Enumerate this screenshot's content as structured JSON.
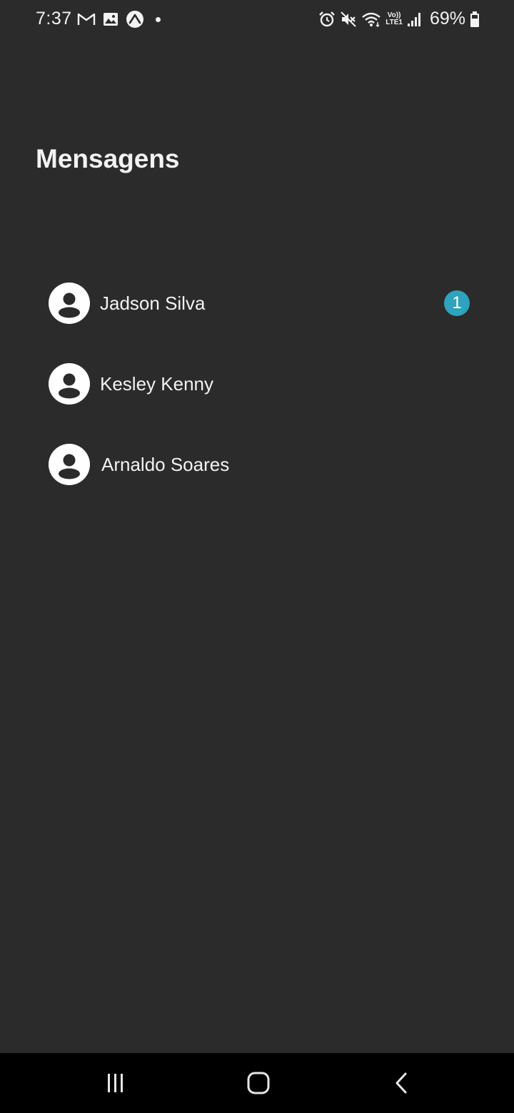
{
  "status_bar": {
    "time": "7:37",
    "battery_percent": "69%",
    "lte_top": "Vo))",
    "lte_bottom": "LTE1",
    "left_icons": [
      "gmail-icon",
      "gallery-icon",
      "expo-icon"
    ],
    "right_icons": [
      "alarm-icon",
      "mute-icon",
      "wifi-icon",
      "signal-icon",
      "battery-icon"
    ]
  },
  "header": {
    "title": "Mensagens"
  },
  "contacts": [
    {
      "name": "Jadson Silva",
      "unread": "1"
    },
    {
      "name": "Kesley Kenny",
      "unread": ""
    },
    {
      "name": "Arnaldo Soares",
      "unread": ""
    }
  ],
  "nav_bar": {
    "buttons": [
      "recent-apps-button",
      "home-button",
      "back-button"
    ]
  },
  "colors": {
    "background": "#2b2b2b",
    "text": "#f2f2f2",
    "badge": "#2fa2bd",
    "nav_bar": "#000000"
  }
}
